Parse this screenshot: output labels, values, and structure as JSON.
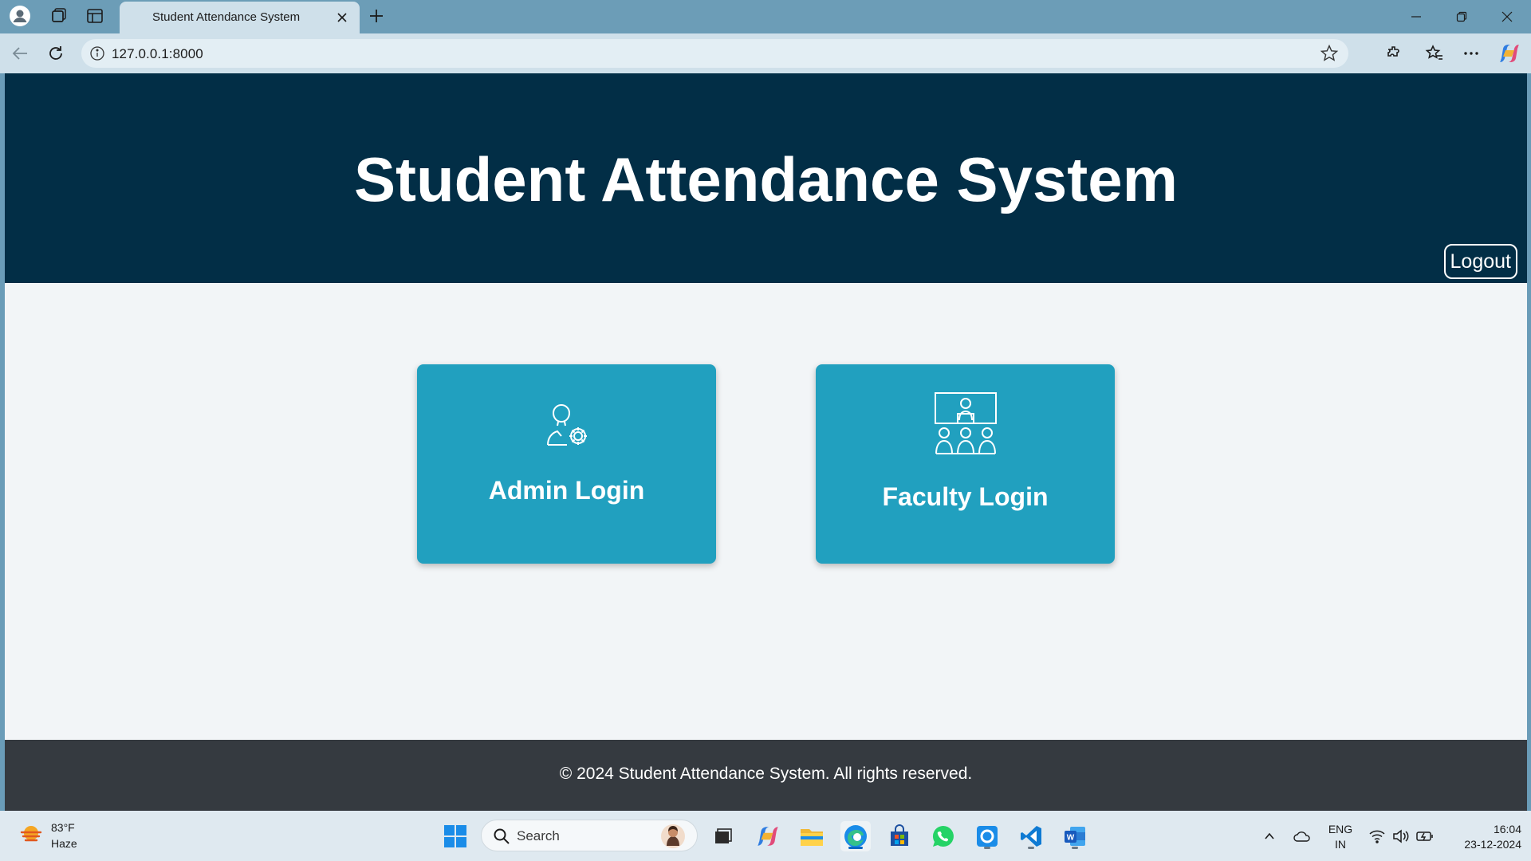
{
  "browser": {
    "tab_title": "Student Attendance System",
    "url": "127.0.0.1:8000"
  },
  "page": {
    "title": "Student Attendance System",
    "logout_label": "Logout",
    "cards": [
      {
        "label": "Admin Login",
        "icon": "admin-settings-icon"
      },
      {
        "label": "Faculty Login",
        "icon": "faculty-classroom-icon"
      }
    ],
    "footer": "© 2024 Student Attendance System. All rights reserved."
  },
  "colors": {
    "header_bg": "#022e46",
    "card_bg": "#21a0bf",
    "footer_bg": "#353a40",
    "page_bg": "#f2f5f7"
  },
  "taskbar": {
    "weather": {
      "temp": "83°F",
      "desc": "Haze"
    },
    "search_placeholder": "Search",
    "lang": {
      "line1": "ENG",
      "line2": "IN"
    },
    "clock": {
      "time": "16:04",
      "date": "23-12-2024"
    }
  }
}
